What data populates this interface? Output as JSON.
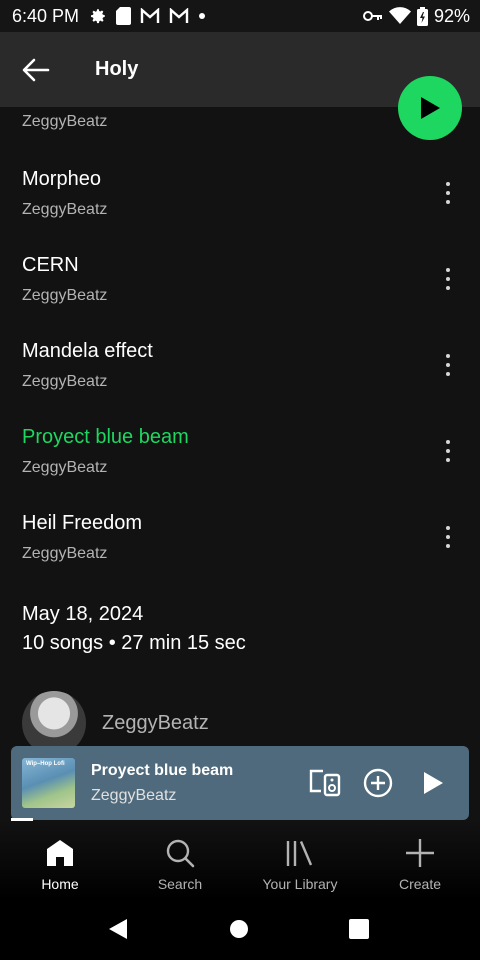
{
  "status_bar": {
    "time": "6:40 PM",
    "battery": "92%",
    "left_icons": [
      "gear-icon",
      "sd-card-icon",
      "gmail-icon",
      "gmail-icon",
      "dot-icon"
    ],
    "right_icons": [
      "key-icon",
      "wifi-icon",
      "battery-icon"
    ]
  },
  "header": {
    "title": "Holy",
    "back_icon": "arrow-left-icon"
  },
  "play_button": {
    "icon": "play-icon",
    "color": "#1ed760"
  },
  "partial_track": {
    "artist": "ZeggyBeatz"
  },
  "tracks": [
    {
      "title": "Morpheo",
      "artist": "ZeggyBeatz",
      "playing": false
    },
    {
      "title": "CERN",
      "artist": "ZeggyBeatz",
      "playing": false
    },
    {
      "title": "Mandela effect",
      "artist": "ZeggyBeatz",
      "playing": false
    },
    {
      "title": "Proyect blue beam",
      "artist": "ZeggyBeatz",
      "playing": true
    },
    {
      "title": "Heil Freedom",
      "artist": "ZeggyBeatz",
      "playing": false
    }
  ],
  "album_info": {
    "release_date": "May 18, 2024",
    "summary": "10 songs • 27 min 15 sec"
  },
  "artist": {
    "name": "ZeggyBeatz"
  },
  "mini_player": {
    "title": "Proyect blue beam",
    "artist": "ZeggyBeatz",
    "art_text": "Wip–Hop Lofi",
    "background": "#4e6a7c",
    "progress": 0.05
  },
  "bottom_nav": [
    {
      "label": "Home",
      "icon": "home-icon",
      "active": true
    },
    {
      "label": "Search",
      "icon": "search-icon",
      "active": false
    },
    {
      "label": "Your Library",
      "icon": "library-icon",
      "active": false
    },
    {
      "label": "Create",
      "icon": "plus-icon",
      "active": false
    }
  ],
  "colors": {
    "accent": "#1ed760",
    "background": "#121212",
    "secondary_text": "#b3b3b3"
  }
}
